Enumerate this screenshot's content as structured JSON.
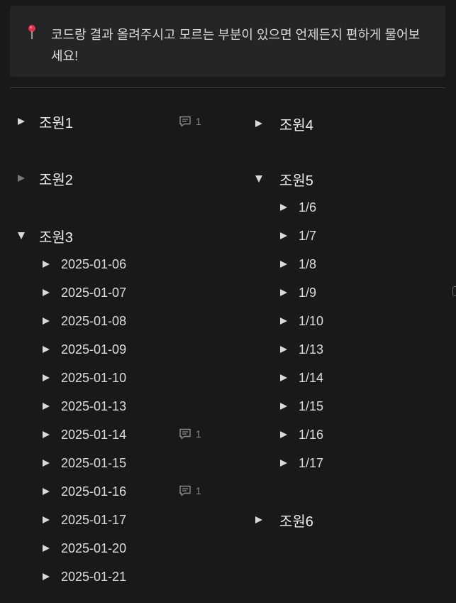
{
  "callout": {
    "icon": "pushpin-icon",
    "text": "코드랑 결과 올려주시고 모르는 부분이 있으면 언제든지 편하게 물어보세요!"
  },
  "left": {
    "group1": {
      "label": "조원1",
      "comments": "1"
    },
    "group2": {
      "label": "조원2"
    },
    "group3": {
      "label": "조원3",
      "items": [
        {
          "label": "2025-01-06"
        },
        {
          "label": "2025-01-07"
        },
        {
          "label": "2025-01-08"
        },
        {
          "label": "2025-01-09"
        },
        {
          "label": "2025-01-10"
        },
        {
          "label": "2025-01-13"
        },
        {
          "label": "2025-01-14",
          "comments": "1"
        },
        {
          "label": "2025-01-15"
        },
        {
          "label": "2025-01-16",
          "comments": "1"
        },
        {
          "label": "2025-01-17"
        },
        {
          "label": "2025-01-20"
        },
        {
          "label": "2025-01-21"
        }
      ]
    }
  },
  "right": {
    "group4": {
      "label": "조원4"
    },
    "group5": {
      "label": "조원5",
      "items": [
        {
          "label": "1/6"
        },
        {
          "label": "1/7"
        },
        {
          "label": "1/8"
        },
        {
          "label": "1/9"
        },
        {
          "label": "1/10"
        },
        {
          "label": "1/13"
        },
        {
          "label": "1/14"
        },
        {
          "label": "1/15"
        },
        {
          "label": "1/16"
        },
        {
          "label": "1/17"
        }
      ]
    },
    "group6": {
      "label": "조원6"
    }
  }
}
